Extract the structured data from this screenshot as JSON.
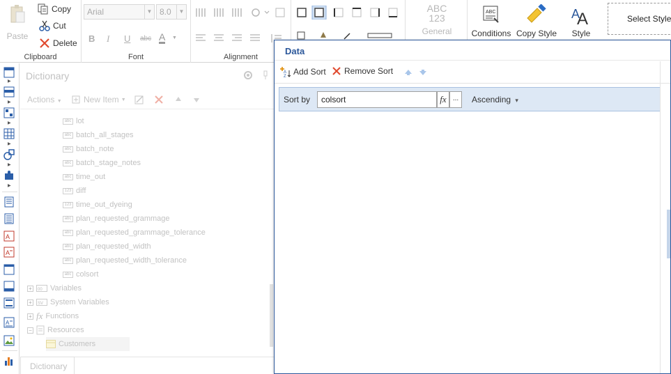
{
  "ribbon": {
    "clipboard": {
      "label": "Clipboard",
      "paste": "Paste",
      "copy": "Copy",
      "cut": "Cut",
      "delete": "Delete"
    },
    "font": {
      "label": "Font",
      "family": "Arial",
      "size": "8.0",
      "bold": "B",
      "italic": "I",
      "underline": "U",
      "strike": "abc",
      "color": "A"
    },
    "alignment": {
      "label": "Alignment"
    },
    "general": {
      "abc": "ABC",
      "num": "123",
      "label": "General"
    },
    "conditions": "Conditions",
    "copy_style": "Copy Style",
    "style": "Style",
    "select_style": "Select Style"
  },
  "dictionary": {
    "title": "Dictionary",
    "actions": "Actions",
    "new_item": "New Item",
    "tab": "Dictionary",
    "fields": [
      {
        "type": "abc",
        "name": "lot"
      },
      {
        "type": "abc",
        "name": "batch_all_stages"
      },
      {
        "type": "abc",
        "name": "batch_note"
      },
      {
        "type": "abc",
        "name": "batch_stage_notes"
      },
      {
        "type": "abc",
        "name": "time_out"
      },
      {
        "type": "123",
        "name": "diff"
      },
      {
        "type": "123",
        "name": "time_out_dyeing"
      },
      {
        "type": "abc",
        "name": "plan_requested_grammage"
      },
      {
        "type": "abc",
        "name": "plan_requested_grammage_tolerance"
      },
      {
        "type": "abc",
        "name": "plan_requested_width"
      },
      {
        "type": "abc",
        "name": "plan_requested_width_tolerance"
      },
      {
        "type": "abc",
        "name": "colsort"
      }
    ],
    "groups": [
      {
        "expander": "+",
        "name": "Variables"
      },
      {
        "expander": "+",
        "name": "System Variables"
      },
      {
        "expander": "+",
        "name": "Functions"
      },
      {
        "expander": "−",
        "name": "Resources"
      }
    ],
    "resource_child": "Customers"
  },
  "dialog": {
    "title": "Data",
    "add_sort": "Add Sort",
    "remove_sort": "Remove Sort",
    "sort_by_label": "Sort by",
    "sort_field": "colsort",
    "fx": "fx",
    "dots": "...",
    "order": "Ascending",
    "order_arrow": "▾"
  }
}
